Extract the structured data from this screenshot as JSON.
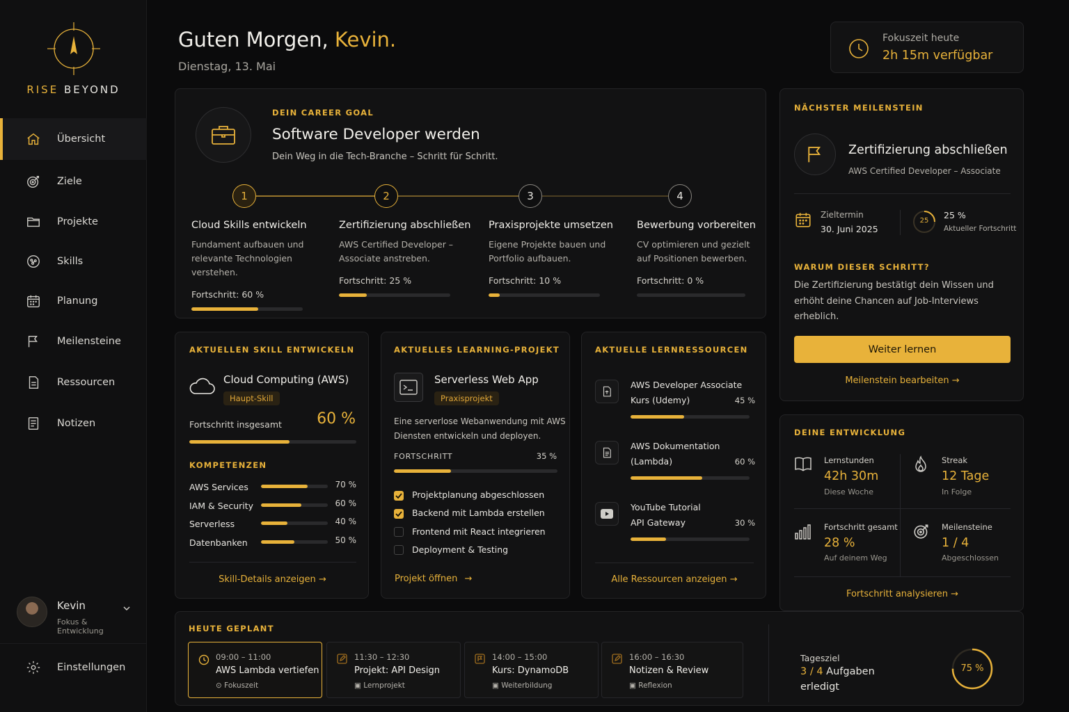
{
  "brand": {
    "name_a": "RISE",
    "name_b": "BEYOND"
  },
  "nav": [
    {
      "label": "Übersicht",
      "icon": "home-icon"
    },
    {
      "label": "Ziele",
      "icon": "target-icon"
    },
    {
      "label": "Projekte",
      "icon": "folder-icon"
    },
    {
      "label": "Skills",
      "icon": "brain-icon"
    },
    {
      "label": "Planung",
      "icon": "calendar-icon"
    },
    {
      "label": "Meilensteine",
      "icon": "flag-icon"
    },
    {
      "label": "Ressourcen",
      "icon": "document-icon"
    },
    {
      "label": "Notizen",
      "icon": "notes-icon"
    }
  ],
  "user": {
    "name": "Kevin",
    "subtitle": "Fokus & Entwicklung"
  },
  "settings_label": "Einstellungen",
  "header": {
    "greeting": "Guten Morgen,",
    "name": "Kevin.",
    "date": "Dienstag, 13. Mai"
  },
  "focus": {
    "label": "Fokuszeit heute",
    "value": "2h 15m verfügbar"
  },
  "goal": {
    "label": "DEIN CAREER GOAL",
    "title": "Software Developer werden",
    "subtitle": "Dein Weg in die Tech-Branche – Schritt für Schritt.",
    "steps": [
      {
        "num": "1",
        "title": "Cloud Skills entwickeln",
        "desc1": "Fundament aufbauen und",
        "desc2": "relevante Technologien verstehen.",
        "progress_label": "Fortschritt: 60 %",
        "progress": 60
      },
      {
        "num": "2",
        "title": "Zertifizierung abschließen",
        "desc1": "AWS Certified Developer –",
        "desc2": "Associate anstreben.",
        "progress_label": "Fortschritt: 25 %",
        "progress": 25
      },
      {
        "num": "3",
        "title": "Praxisprojekte umsetzen",
        "desc1": "Eigene Projekte bauen und",
        "desc2": "Portfolio aufbauen.",
        "progress_label": "Fortschritt: 10 %",
        "progress": 10
      },
      {
        "num": "4",
        "title": "Bewerbung vorbereiten",
        "desc1": "CV optimieren und gezielt",
        "desc2": "auf Positionen bewerben.",
        "progress_label": "Fortschritt: 0 %",
        "progress": 0
      }
    ]
  },
  "milestone": {
    "label": "NÄCHSTER MEILENSTEIN",
    "title": "Zertifizierung abschließen",
    "subtitle": "AWS Certified Developer – Associate",
    "date_label": "Zieltermin",
    "date": "30. Juni 2025",
    "progress_text": "25 %",
    "progress_ring": "25",
    "progress_sub": "Aktueller Fortschritt",
    "progress": 25,
    "why_label": "WARUM DIESER SCHRITT?",
    "why1": "Die Zertifizierung bestätigt dein Wissen und",
    "why2": "erhöht deine Chancen auf Job-Interviews",
    "why3": "erheblich.",
    "cta": "Weiter lernen",
    "edit_link": "Meilenstein bearbeiten"
  },
  "skill": {
    "label": "AKTUELLEN SKILL ENTWICKELN",
    "title": "Cloud Computing (AWS)",
    "badge": "Haupt-Skill",
    "overall_label": "Fortschritt insgesamt",
    "overall_value": "60 %",
    "overall": 60,
    "comp_label": "KOMPETENZEN",
    "competencies": [
      {
        "name": "AWS Services",
        "value": "70 %",
        "pct": 70
      },
      {
        "name": "IAM & Security",
        "value": "60 %",
        "pct": 60
      },
      {
        "name": "Serverless",
        "value": "40 %",
        "pct": 40
      },
      {
        "name": "Datenbanken",
        "value": "50 %",
        "pct": 50
      }
    ],
    "link": "Skill-Details anzeigen"
  },
  "project": {
    "label": "AKTUELLES LEARNING-PROJEKT",
    "title": "Serverless Web App",
    "badge": "Praxisprojekt",
    "desc1": "Eine serverlose Webanwendung mit AWS",
    "desc2": "Diensten entwickeln und deployen.",
    "progress_label": "FORTSCHRITT",
    "progress_value": "35 %",
    "progress": 35,
    "tasks": [
      {
        "label": "Projektplanung abgeschlossen",
        "done": true
      },
      {
        "label": "Backend mit Lambda erstellen",
        "done": true
      },
      {
        "label": "Frontend mit React integrieren",
        "done": false
      },
      {
        "label": "Deployment & Testing",
        "done": false
      }
    ],
    "link": "Projekt öffnen"
  },
  "resources": {
    "label": "AKTUELLE LERNRESSOURCEN",
    "items": [
      {
        "line1": "AWS Developer Associate",
        "line2": "Kurs (Udemy)",
        "value": "45 %",
        "pct": 45,
        "icon": "course-icon"
      },
      {
        "line1": "AWS Dokumentation",
        "line2": "(Lambda)",
        "value": "60 %",
        "pct": 60,
        "icon": "document-icon"
      },
      {
        "line1": "YouTube Tutorial",
        "line2": "API Gateway",
        "value": "30 %",
        "pct": 30,
        "icon": "play-icon"
      }
    ],
    "link": "Alle Ressourcen anzeigen"
  },
  "development": {
    "label": "DEINE ENTWICKLUNG",
    "stats": [
      {
        "label": "Lernstunden",
        "value": "42h 30m",
        "sub": "Diese Woche"
      },
      {
        "label": "Streak",
        "value": "12 Tage",
        "sub": "In Folge"
      },
      {
        "label": "Fortschritt gesamt",
        "value": "28 %",
        "sub": "Auf deinem Weg"
      },
      {
        "label": "Meilensteine",
        "value": "1 / 4",
        "sub": "Abgeschlossen"
      }
    ],
    "link": "Fortschritt analysieren"
  },
  "today": {
    "label": "HEUTE GEPLANT",
    "items": [
      {
        "time": "09:00 – 11:00",
        "title": "AWS Lambda vertiefen",
        "tag": "Fokuszeit"
      },
      {
        "time": "11:30 – 12:30",
        "title": "Projekt: API Design",
        "tag": "Lernprojekt"
      },
      {
        "time": "14:00 – 15:00",
        "title": "Kurs: DynamoDB",
        "tag": "Weiterbildung"
      },
      {
        "time": "16:00 – 16:30",
        "title": "Notizen & Review",
        "tag": "Reflexion"
      }
    ],
    "goal_label": "Tagesziel",
    "goal_count": "3 / 4",
    "goal_text1": "Aufgaben",
    "goal_text2": "erledigt",
    "goal_ring": "75 %",
    "goal_pct": 75
  },
  "colors": {
    "accent": "#e8b23a",
    "bg": "#0b0b0c",
    "card": "#121213"
  }
}
